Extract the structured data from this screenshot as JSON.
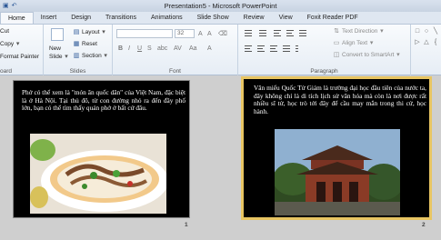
{
  "window": {
    "title": "Presentation5 - Microsoft PowerPoint"
  },
  "ribbon_tabs": [
    "Home",
    "Insert",
    "Design",
    "Transitions",
    "Animations",
    "Slide Show",
    "Review",
    "View",
    "Foxit Reader PDF"
  ],
  "ribbon": {
    "clipboard": {
      "cut": "Cut",
      "copy": "Copy",
      "format_painter": "Format Painter",
      "label": "oard"
    },
    "slides": {
      "new_slide": "New",
      "new_slide_2": "Slide",
      "layout": "Layout",
      "reset": "Reset",
      "section": "Section",
      "label": "Slides"
    },
    "font": {
      "size": "32",
      "label": "Font"
    },
    "paragraph": {
      "text_direction": "Text Direction",
      "align_text": "Align Text",
      "convert_smartart": "Convert to SmartArt",
      "label": "Paragraph"
    }
  },
  "slides": [
    {
      "number": "1",
      "text": "Phở có thể xem là \"món ăn quốc dân\" của Việt Nam, đặc biệt là ở Hà Nội. Tại thủ đô, từ con đường nhỏ ra đến đầy phố lớn, bạn có thể tìm thấy quán phở ở bất cứ đâu."
    },
    {
      "number": "2",
      "text": "Văn miếu Quốc Tử Giám là trường đại học đầu tiên của nước ta, đây không chỉ là di tích lịch sử văn hóa mà còn là nơi được rất nhiều sĩ tử, học trò tới đây để cầu may mắn trong thi cử, học hành."
    }
  ],
  "colors": {
    "selected_slide_border": "#e8c562",
    "slide_background": "#000000"
  }
}
